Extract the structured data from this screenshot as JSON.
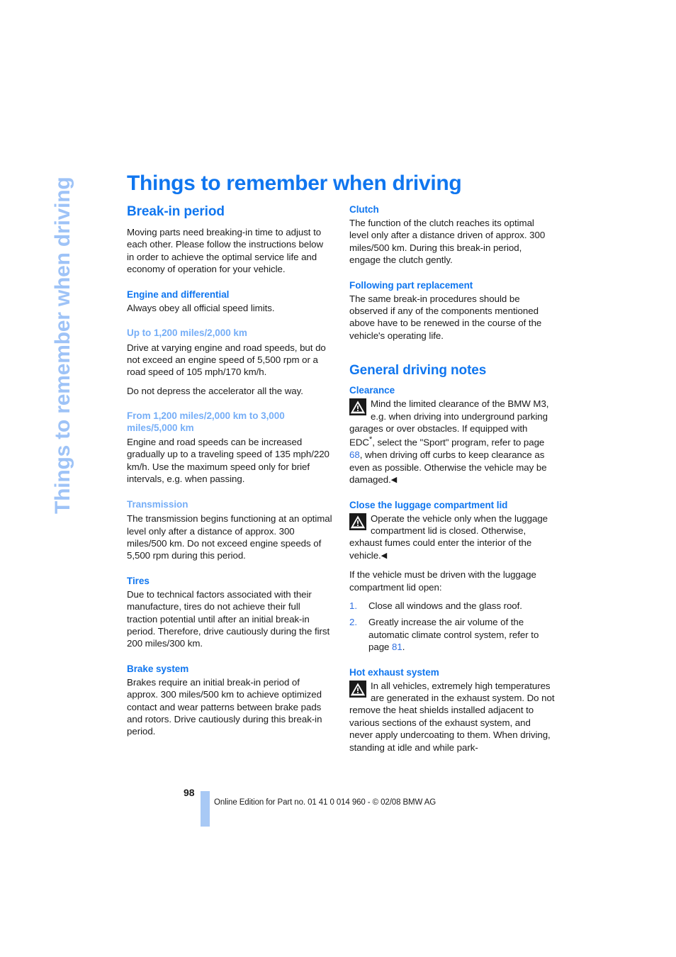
{
  "sidebar": {
    "chapter_tab_label": "Things to remember when driving"
  },
  "page_title": "Things to remember when driving",
  "left_column": {
    "section_break_in": {
      "heading": "Break-in period",
      "intro": "Moving parts need breaking-in time to adjust to each other. Please follow the instructions below in order to achieve the optimal service life and economy of operation for your vehicle.",
      "engine_differential": {
        "heading": "Engine and differential",
        "body": "Always obey all official speed limits."
      },
      "up_to_1200": {
        "heading": "Up to 1,200 miles/2,000 km",
        "body_1": "Drive at varying engine and road speeds, but do not exceed an engine speed of 5,500 rpm or a road speed of 105 mph/170 km/h.",
        "body_2": "Do not depress the accelerator all the way."
      },
      "from_1200_to_3000": {
        "heading": "From 1,200 miles/2,000 km to 3,000 miles/5,000 km",
        "body": "Engine and road speeds can be increased gradually up to a traveling speed of 135 mph/220 km/h. Use the maximum speed only for brief intervals, e.g. when passing."
      },
      "transmission": {
        "heading": "Transmission",
        "body": "The transmission begins functioning at an optimal level only after a distance of approx. 300 miles/500 km. Do not exceed engine speeds of 5,500 rpm during this period."
      },
      "tires": {
        "heading": "Tires",
        "body": "Due to technical factors associated with their manufacture, tires do not achieve their full traction potential until after an initial break-in period. Therefore, drive cautiously during the first 200 miles/300 km."
      },
      "brake_system": {
        "heading": "Brake system",
        "body": "Brakes require an initial break-in period of approx. 300 miles/500 km to achieve optimized contact and wear patterns between brake pads and rotors. Drive cautiously during this break-in period."
      }
    }
  },
  "right_column": {
    "clutch": {
      "heading": "Clutch",
      "body": "The function of the clutch reaches its optimal level only after a distance driven of approx. 300 miles/500 km. During this break-in period, engage the clutch gently."
    },
    "following_part_replacement": {
      "heading": "Following part replacement",
      "body": "The same break-in procedures should be observed if any of the components mentioned above have to be renewed in the course of the vehicle's operating life."
    },
    "section_general_driving": {
      "heading": "General driving notes",
      "clearance": {
        "heading": "Clearance",
        "warning_part_1": "Mind the limited clearance of the BMW M3, e.g. when driving into underground parking garages or over obstacles. If equipped with EDC",
        "asterisk": "*",
        "warning_part_2": ", select the \"Sport\" program, refer to page ",
        "page_ref": "68",
        "warning_part_3": ", when driving off curbs to keep clearance as even as possible. Otherwise the vehicle may be damaged.",
        "end_marker": "◀"
      },
      "luggage_lid": {
        "heading": "Close the luggage compartment lid",
        "warning": "Operate the vehicle only when the luggage compartment lid is closed. Otherwise, exhaust fumes could enter the interior of the vehicle.",
        "end_marker": "◀",
        "intro": "If the vehicle must be driven with the luggage compartment lid open:",
        "steps": [
          {
            "num": "1.",
            "text": "Close all windows and the glass roof."
          },
          {
            "num": "2.",
            "text_before_ref": "Greatly increase the air volume of the automatic climate control system, refer to page ",
            "page_ref": "81",
            "text_after_ref": "."
          }
        ]
      },
      "hot_exhaust": {
        "heading": "Hot exhaust system",
        "warning": "In all vehicles, extremely high temperatures are generated in the exhaust system. Do not remove the heat shields installed adjacent to various sections of the exhaust system, and never apply undercoating to them. When driving, standing at idle and while park-"
      }
    }
  },
  "footer": {
    "page_number": "98",
    "edition_text": "Online Edition for Part no. 01 41 0 014 960 - © 02/08 BMW AG"
  },
  "colors": {
    "heading_blue": "#1076ef",
    "subheading_light_blue": "#76aef7",
    "tab_blue": "#9ec3f7",
    "footer_bar_blue": "#a8c9f5",
    "page_ref_blue": "#2f6fe0"
  }
}
